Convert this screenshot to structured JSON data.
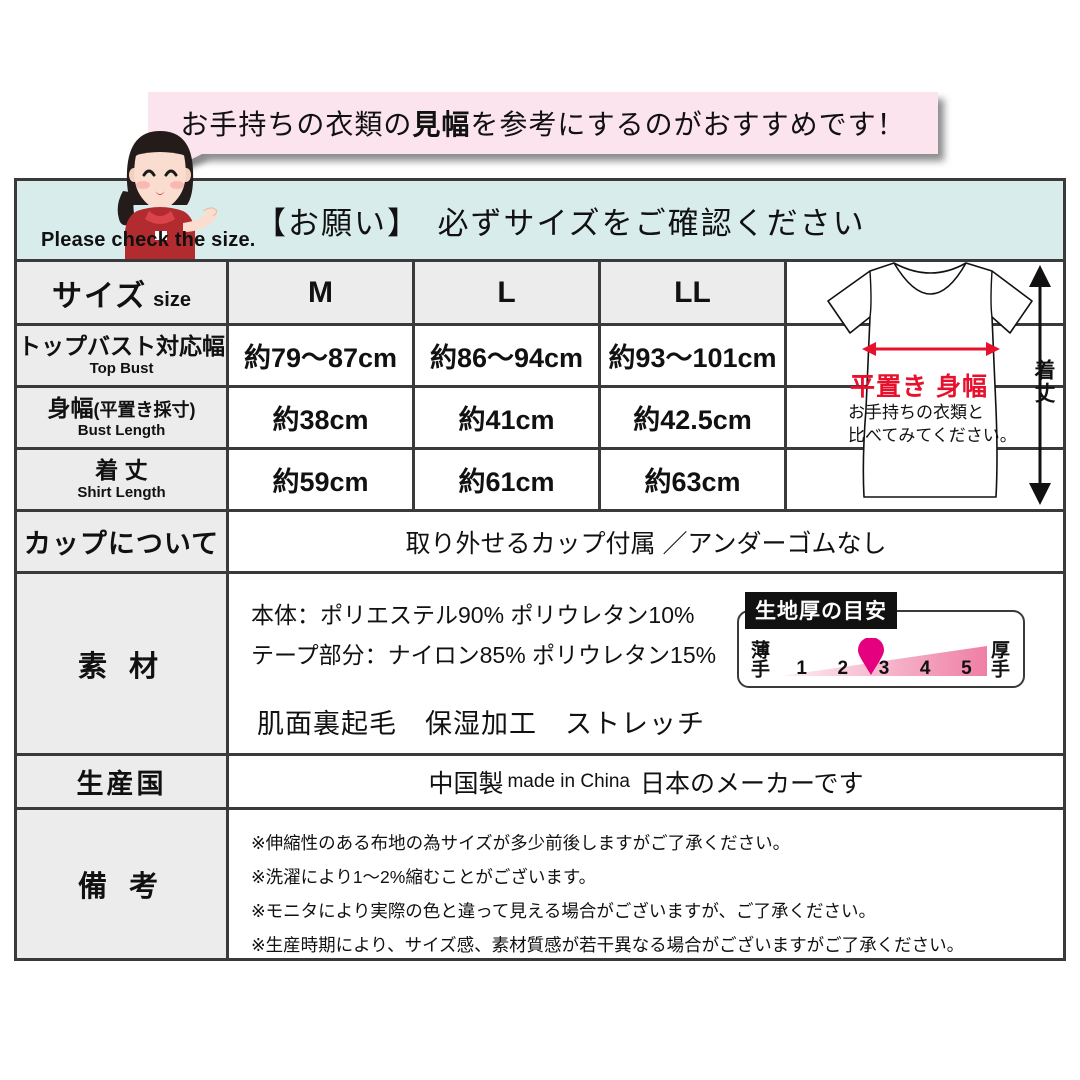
{
  "bubble": {
    "text_before": "お手持ちの衣類の",
    "text_bold": "見幅",
    "text_after": "を参考にするのがおすすめです！"
  },
  "banner": {
    "title": "【お願い】　必ずサイズをご確認ください",
    "english": "Please check the size.",
    "bg_color": "#d9ecec",
    "illustration": "shopkeeper-woman-icon"
  },
  "size_table": {
    "header": {
      "label_ja": "サイズ",
      "label_en": "size",
      "sizes": [
        "M",
        "L",
        "LL"
      ]
    },
    "rows": [
      {
        "label_ja": "トップバスト対応幅",
        "label_ja_sub": "",
        "label_en": "Top Bust",
        "values": [
          "約79〜87cm",
          "約86〜94cm",
          "約93〜101cm"
        ]
      },
      {
        "label_ja": "身幅",
        "label_ja_sub": "(平置き採寸)",
        "label_en": "Bust Length",
        "values": [
          "約38cm",
          "約41cm",
          "約42.5cm"
        ]
      },
      {
        "label_ja": "着 丈",
        "label_ja_sub": "",
        "label_en": "Shirt Length",
        "values": [
          "約59cm",
          "約61cm",
          "約63cm"
        ]
      }
    ]
  },
  "shirt_diagram": {
    "width_label": "平置き 身幅",
    "width_note_line1": "お手持ちの衣類と",
    "width_note_line2": "比べてみてください。",
    "length_label": "着丈",
    "arrow_color": "#e8112d"
  },
  "cup": {
    "label": "カップについて",
    "value": "取り外せるカップ付属 ／アンダーゴムなし"
  },
  "material": {
    "label": "素 材",
    "line1": "本体：ポリエステル90% ポリウレタン10%",
    "line2": "テープ部分：ナイロン85% ポリウレタン15%",
    "features": "肌面裏起毛　保湿加工　ストレッチ"
  },
  "thickness_gauge": {
    "title": "生地厚の目安",
    "thin_label": "薄手",
    "thick_label": "厚手",
    "scale": [
      "1",
      "2",
      "3",
      "4",
      "5"
    ],
    "marker_value": "2.5",
    "marker_color": "#e5007f",
    "gradient_color": "#f4a9c0"
  },
  "country": {
    "label": "生産国",
    "value_ja": "中国製",
    "value_en": "made in China",
    "value_note": "日本のメーカーです"
  },
  "notes": {
    "label": "備 考",
    "items": [
      "※伸縮性のある布地の為サイズが多少前後しますがご了承ください。",
      "※洗濯により1〜2%縮むことがございます。",
      "※モニタにより実際の色と違って見える場合がございますが、ご了承ください。",
      "※生産時期により、サイズ感、素材質感が若干異なる場合がございますがご了承ください。"
    ]
  }
}
